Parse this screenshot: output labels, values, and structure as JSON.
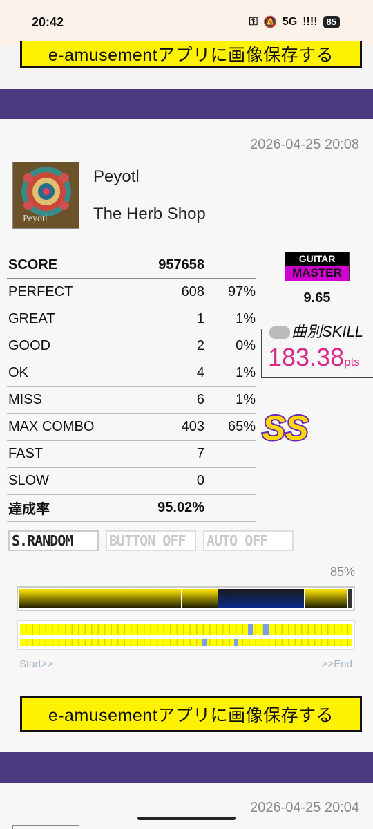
{
  "status_bar": {
    "time": "20:42",
    "network": "5G",
    "signal": "!!!!",
    "battery": "85",
    "key_icon": "key-icon",
    "mute_icon": "mute-icon"
  },
  "save_button_label": "e-amusementアプリに画像保存する",
  "entry": {
    "date": "2026-04-25 20:08",
    "title": "Peyotl",
    "artist": "The Herb Shop",
    "jacket_text": "Peyotl",
    "stats": [
      {
        "name": "SCORE",
        "value": "957658",
        "pct": ""
      },
      {
        "name": "PERFECT",
        "value": "608",
        "pct": "97%"
      },
      {
        "name": "GREAT",
        "value": "1",
        "pct": "1%"
      },
      {
        "name": "GOOD",
        "value": "2",
        "pct": "0%"
      },
      {
        "name": "OK",
        "value": "4",
        "pct": "1%"
      },
      {
        "name": "MISS",
        "value": "6",
        "pct": "1%"
      },
      {
        "name": "MAX COMBO",
        "value": "403",
        "pct": "65%"
      },
      {
        "name": "FAST",
        "value": "7",
        "pct": ""
      },
      {
        "name": "SLOW",
        "value": "0",
        "pct": ""
      },
      {
        "name": "達成率",
        "value": "95.02%",
        "pct": ""
      }
    ],
    "part": "GUITAR",
    "difficulty": "MASTER",
    "level": "9.65",
    "skill_label": "曲別SKILL",
    "skill_value": "183.38",
    "skill_unit": "pts",
    "rank": "SS",
    "options": [
      "S.RANDOM",
      "BUTTON OFF",
      "AUTO OFF"
    ],
    "gauge_percent": "85%",
    "timeline_start": "Start>>",
    "timeline_end": ">>End"
  },
  "next_entry": {
    "date": "2026-04-25 20:04"
  },
  "colors": {
    "purple_band": "#4b3a7f",
    "save_button": "#fff200",
    "skill_pink": "#d8288a",
    "master_magenta": "#d000d0",
    "gauge_yellow": "#ffe600",
    "gauge_blue": "#0a2a8a"
  }
}
